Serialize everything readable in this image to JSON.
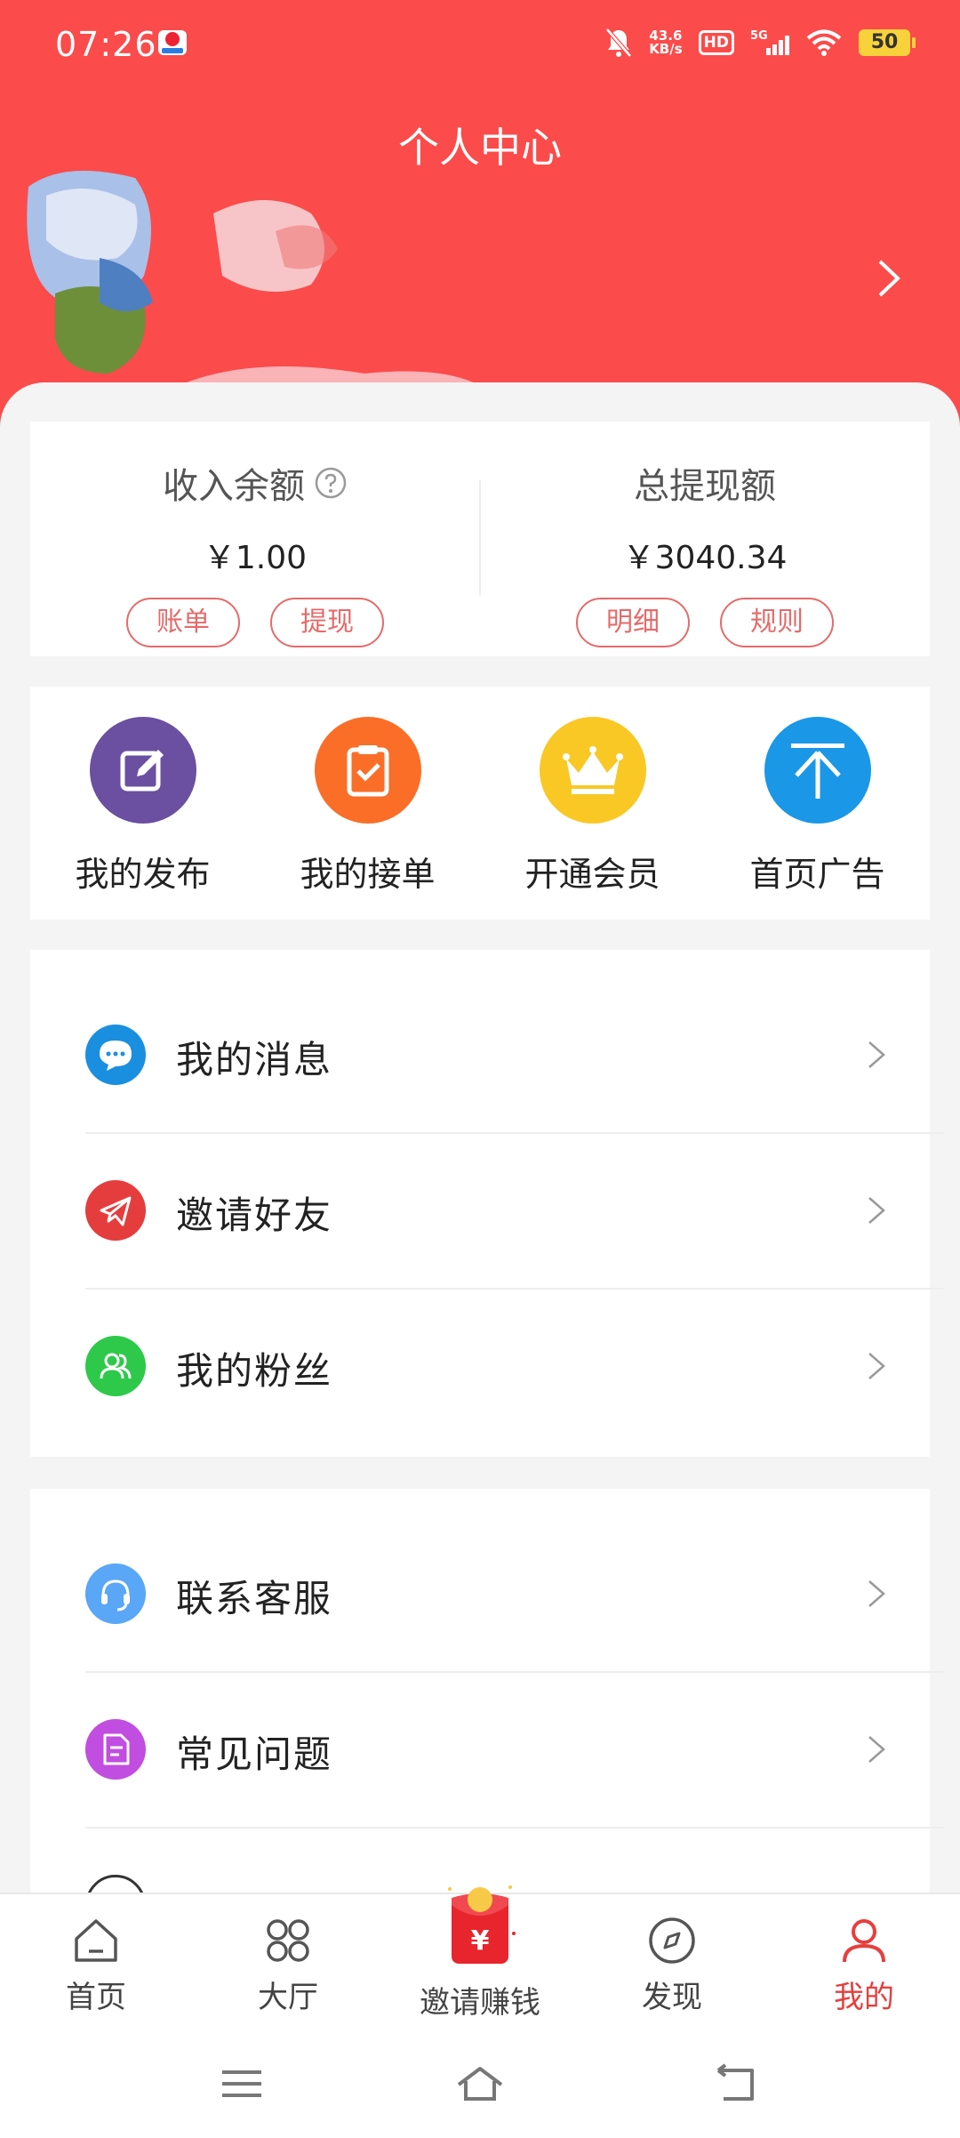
{
  "status_bar": {
    "time": "07:26",
    "net_speed_value": "43.6",
    "net_speed_unit": "KB/s",
    "hd_label": "HD",
    "network_label": "5G",
    "battery": "50"
  },
  "header": {
    "title": "个人中心"
  },
  "balance": {
    "income_label": "收入余额",
    "income_value": "￥1.00",
    "income_buttons": [
      "账单",
      "提现"
    ],
    "withdraw_label": "总提现额",
    "withdraw_value": "￥3040.34",
    "withdraw_buttons": [
      "明细",
      "规则"
    ]
  },
  "shortcuts": [
    {
      "label": "我的发布",
      "color": "#6b4fa0",
      "icon": "edit-icon"
    },
    {
      "label": "我的接单",
      "color": "#fa6e28",
      "icon": "clipboard-check-icon"
    },
    {
      "label": "开通会员",
      "color": "#f9c825",
      "icon": "crown-icon"
    },
    {
      "label": "首页广告",
      "color": "#1a97e6",
      "icon": "arrow-up-icon"
    }
  ],
  "menu_group_1": [
    {
      "label": "我的消息",
      "color": "#1a8fe0",
      "icon": "message-icon"
    },
    {
      "label": "邀请好友",
      "color": "#e53d3d",
      "icon": "paper-plane-icon"
    },
    {
      "label": "我的粉丝",
      "color": "#2ec94a",
      "icon": "fans-icon"
    }
  ],
  "menu_group_2": [
    {
      "label": "联系客服",
      "color": "#5aa6f7",
      "icon": "headset-icon"
    },
    {
      "label": "常见问题",
      "color": "#c14ee0",
      "icon": "document-icon"
    }
  ],
  "tab_bar": [
    {
      "label": "首页",
      "icon": "home-icon"
    },
    {
      "label": "大厅",
      "icon": "grid-icon"
    },
    {
      "label": "邀请赚钱",
      "icon": "red-packet-icon"
    },
    {
      "label": "发现",
      "icon": "compass-icon"
    },
    {
      "label": "我的",
      "icon": "person-icon",
      "active": true
    }
  ],
  "colors": {
    "header_bg": "#fb4b4b",
    "accent": "#e83e3e"
  }
}
